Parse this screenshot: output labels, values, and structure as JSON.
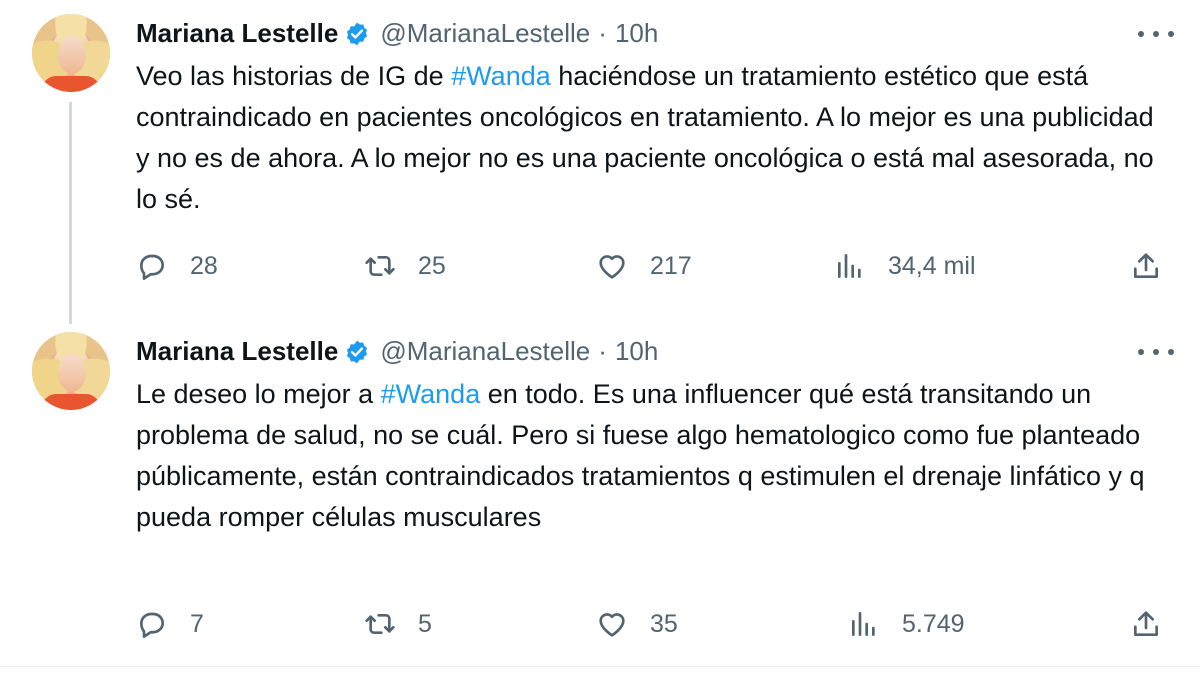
{
  "tweets": [
    {
      "author_name": "Mariana Lestelle",
      "handle": "@MarianaLestelle",
      "separator": "·",
      "time": "10h",
      "text_before": "Veo las historias de IG de ",
      "hashtag": "#Wanda",
      "text_after": " haciéndose un tratamiento estético que está contraindicado en pacientes oncológicos en tratamiento. A lo mejor es una publicidad y no es de ahora. A lo mejor no es una paciente oncológica o está mal asesorada, no lo sé.",
      "replies": "28",
      "retweets": "25",
      "likes": "217",
      "views": "34,4 mil"
    },
    {
      "author_name": "Mariana Lestelle",
      "handle": "@MarianaLestelle",
      "separator": "·",
      "time": "10h",
      "text_before": "Le deseo lo mejor a ",
      "hashtag": "#Wanda",
      "text_after": " en todo. Es una influencer qué está transitando un problema de salud, no se cuál. Pero si fuese algo hematologico como fue planteado públicamente, están contraindicados tratamientos q estimulen el drenaje linfático y q pueda romper células musculares",
      "replies": "7",
      "retweets": "5",
      "likes": "35",
      "views": "5.749"
    }
  ],
  "colors": {
    "text": "#0f1419",
    "secondary": "#536471",
    "hashtag": "#1d9bf0",
    "verified": "#1d9bf0",
    "thread_line": "#cfd9de"
  },
  "icons": [
    "verified-badge-icon",
    "more-icon",
    "reply-icon",
    "retweet-icon",
    "like-icon",
    "views-icon",
    "share-icon"
  ]
}
